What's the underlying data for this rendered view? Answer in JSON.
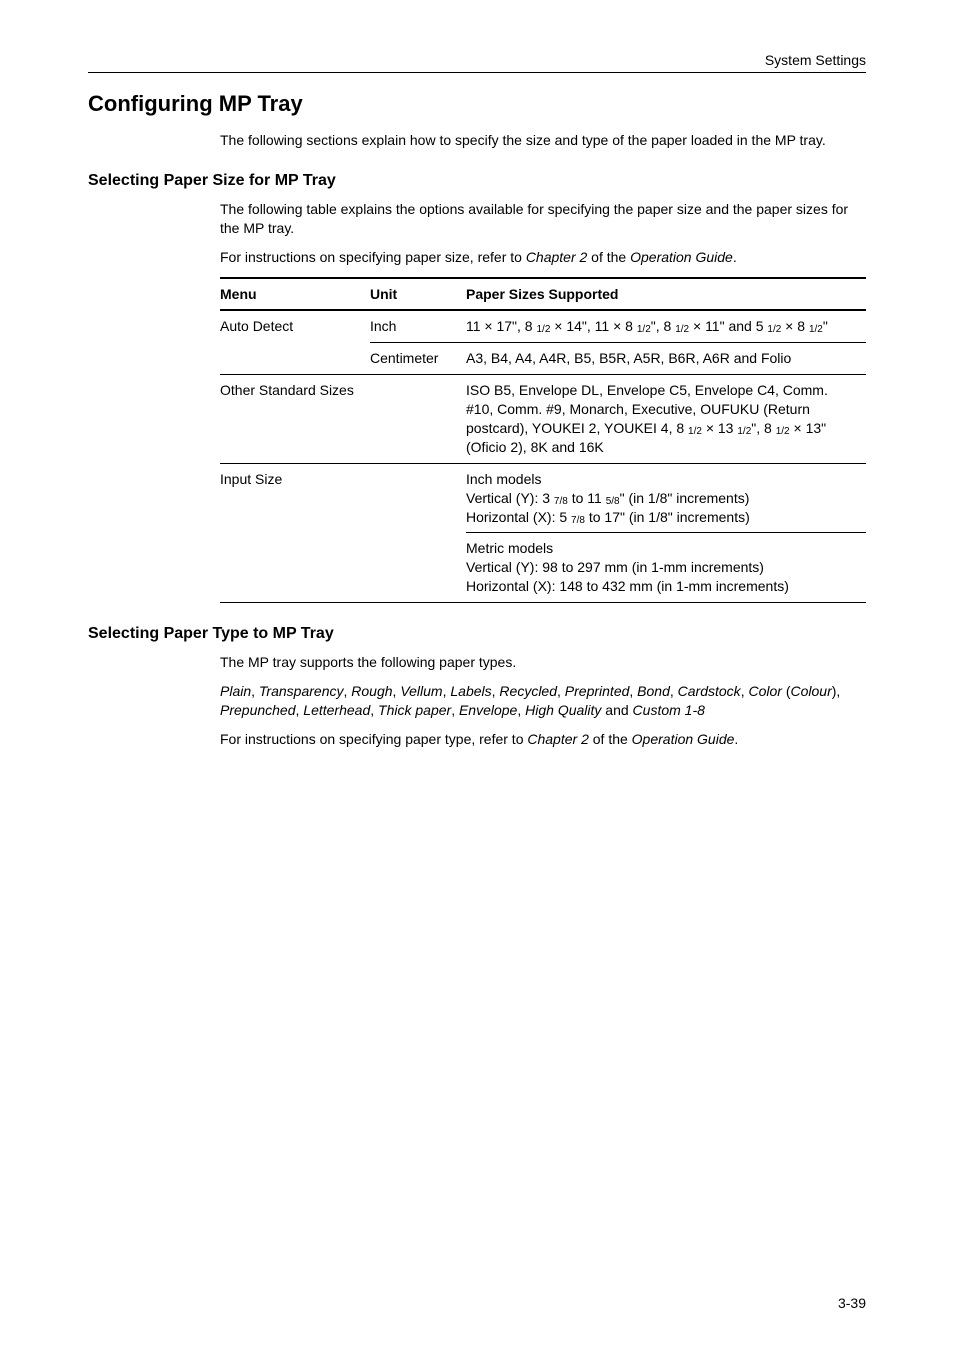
{
  "header": {
    "breadcrumb": "System Settings"
  },
  "title": "Configuring MP Tray",
  "intro": "The following sections explain how to specify the size and type of the paper loaded in the MP tray.",
  "section_size": {
    "heading": "Selecting Paper Size for MP Tray",
    "p1": "The following table explains the options available for specifying the paper size and the paper sizes for the MP tray.",
    "p2_pre": "For instructions on specifying paper size, refer to ",
    "p2_em1": "Chapter 2",
    "p2_mid": " of the ",
    "p2_em2": "Operation Guide",
    "p2_post": ".",
    "table": {
      "headers": {
        "menu": "Menu",
        "unit": "Unit",
        "sizes": "Paper Sizes Supported"
      },
      "rows": {
        "auto_detect_label": "Auto Detect",
        "inch_label": "Inch",
        "inch_sizes": "11 × 17\", 8 1/2 × 14\", 11 × 8 1/2\", 8 1/2 × 11\" and 5 1/2 × 8 1/2\"",
        "cm_label": "Centimeter",
        "cm_sizes": "A3, B4, A4, A4R, B5, B5R, A5R, B6R, A6R and Folio",
        "other_label": "Other Standard Sizes",
        "other_sizes": "ISO B5, Envelope DL, Envelope C5, Envelope C4, Comm. #10, Comm. #9, Monarch, Executive, OUFUKU (Return postcard), YOUKEI 2, YOUKEI 4, 8 1/2 × 13 1/2\", 8 1/2 × 13\" (Oficio 2), 8K and 16K",
        "input_label": "Input Size",
        "input_inch_l1": "Inch models",
        "input_inch_l2": "Vertical (Y): 3 7/8 to 11 5/8\" (in 1/8\" increments)",
        "input_inch_l3": "Horizontal (X): 5 7/8 to 17\" (in 1/8\" increments)",
        "input_metric_l1": "Metric models",
        "input_metric_l2": "Vertical (Y): 98 to 297 mm (in 1-mm increments)",
        "input_metric_l3": "Horizontal (X): 148 to 432 mm (in 1-mm increments)"
      }
    }
  },
  "section_type": {
    "heading": "Selecting Paper Type to MP Tray",
    "p1": "The MP tray supports the following paper types.",
    "list_items": [
      "Plain",
      "Transparency",
      "Rough",
      "Vellum",
      "Labels",
      "Recycled",
      "Preprinted",
      "Bond",
      "Cardstock",
      "Color",
      "Colour",
      "Prepunched",
      "Letterhead",
      "Thick paper",
      "Envelope",
      "High Quality",
      "Custom 1-8"
    ],
    "p3_pre": "For instructions on specifying paper type, refer to ",
    "p3_em1": "Chapter 2",
    "p3_mid": " of the ",
    "p3_em2": "Operation Guide",
    "p3_post": "."
  },
  "chart_data": {
    "type": "table",
    "title": "Paper Sizes Supported by MP Tray Menu Option",
    "columns": [
      "Menu",
      "Unit",
      "Paper Sizes Supported"
    ],
    "rows": [
      [
        "Auto Detect",
        "Inch",
        "11 × 17\", 8 1/2 × 14\", 11 × 8 1/2\", 8 1/2 × 11\" and 5 1/2 × 8 1/2\""
      ],
      [
        "Auto Detect",
        "Centimeter",
        "A3, B4, A4, A4R, B5, B5R, A5R, B6R, A6R and Folio"
      ],
      [
        "Other Standard Sizes",
        "",
        "ISO B5, Envelope DL, Envelope C5, Envelope C4, Comm. #10, Comm. #9, Monarch, Executive, OUFUKU (Return postcard), YOUKEI 2, YOUKEI 4, 8 1/2 × 13 1/2\", 8 1/2 × 13\" (Oficio 2), 8K and 16K"
      ],
      [
        "Input Size",
        "",
        "Inch models: Vertical (Y) 3 7/8 to 11 5/8\" (1/8\" increments); Horizontal (X) 5 7/8 to 17\" (1/8\" increments). Metric models: Vertical (Y) 98 to 297 mm (1-mm increments); Horizontal (X) 148 to 432 mm (1-mm increments)."
      ]
    ]
  },
  "footer": {
    "page_number": "3-39"
  }
}
